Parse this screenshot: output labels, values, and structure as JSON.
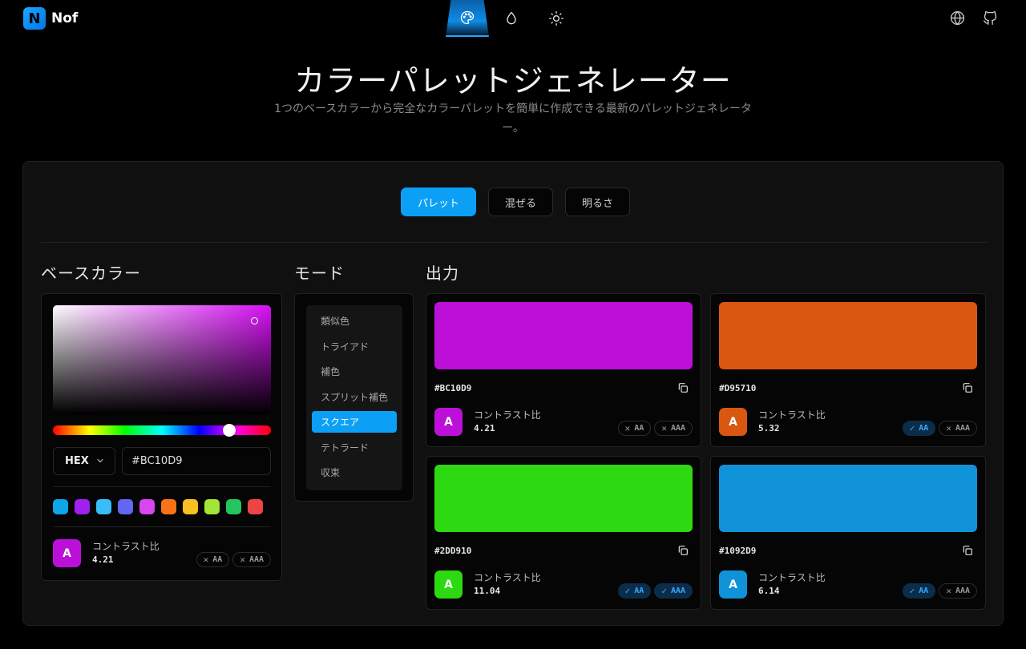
{
  "app": {
    "logo_letter": "N",
    "name": "Nof"
  },
  "nav": {
    "icons": [
      "palette-icon",
      "droplet-icon",
      "sun-icon"
    ],
    "active": "palette-icon"
  },
  "header_icons": [
    "globe-icon",
    "github-icon"
  ],
  "hero": {
    "title": "カラーパレットジェネレーター",
    "subtitle": "1つのベースカラーから完全なカラーパレットを簡単に作成できる最新のパレットジェネレーター。"
  },
  "tabs": [
    {
      "label": "パレット",
      "active": true
    },
    {
      "label": "混ぜる",
      "active": false
    },
    {
      "label": "明るさ",
      "active": false
    }
  ],
  "base": {
    "title": "ベースカラー",
    "hue_color": "#D70FF5",
    "format": "HEX",
    "hex_value": "#BC10D9",
    "swatch_colors": [
      "#0EA5E9",
      "#A020F0",
      "#38BDF8",
      "#6366F1",
      "#D946EF",
      "#F97316",
      "#FBBF24",
      "#A3E635",
      "#22C55E",
      "#EF4444"
    ],
    "contrast": {
      "avatar": "A",
      "color": "#BC10D9",
      "label": "コントラスト比",
      "value": "4.21",
      "badges": [
        {
          "mark": "✕",
          "label": "AA",
          "pass": false
        },
        {
          "mark": "✕",
          "label": "AAA",
          "pass": false
        }
      ]
    }
  },
  "mode": {
    "title": "モード",
    "items": [
      "類似色",
      "トライアド",
      "補色",
      "スプリット補色",
      "スクエア",
      "テトラード",
      "収束"
    ],
    "active_index": 4
  },
  "output": {
    "title": "出力",
    "colors": [
      {
        "hex": "#BC10D9",
        "color": "#BC10D9",
        "avatar": "A",
        "label": "コントラスト比",
        "value": "4.21",
        "badges": [
          {
            "mark": "✕",
            "label": "AA",
            "pass": false
          },
          {
            "mark": "✕",
            "label": "AAA",
            "pass": false
          }
        ]
      },
      {
        "hex": "#D95710",
        "color": "#D95710",
        "avatar": "A",
        "label": "コントラスト比",
        "value": "5.32",
        "badges": [
          {
            "mark": "✓",
            "label": "AA",
            "pass": true
          },
          {
            "mark": "✕",
            "label": "AAA",
            "pass": false
          }
        ]
      },
      {
        "hex": "#2DD910",
        "color": "#2DD910",
        "avatar": "A",
        "label": "コントラスト比",
        "value": "11.04",
        "badges": [
          {
            "mark": "✓",
            "label": "AA",
            "pass": true
          },
          {
            "mark": "✓",
            "label": "AAA",
            "pass": true
          }
        ]
      },
      {
        "hex": "#1092D9",
        "color": "#1092D9",
        "avatar": "A",
        "label": "コントラスト比",
        "value": "6.14",
        "badges": [
          {
            "mark": "✓",
            "label": "AA",
            "pass": true
          },
          {
            "mark": "✕",
            "label": "AAA",
            "pass": false
          }
        ]
      }
    ]
  }
}
